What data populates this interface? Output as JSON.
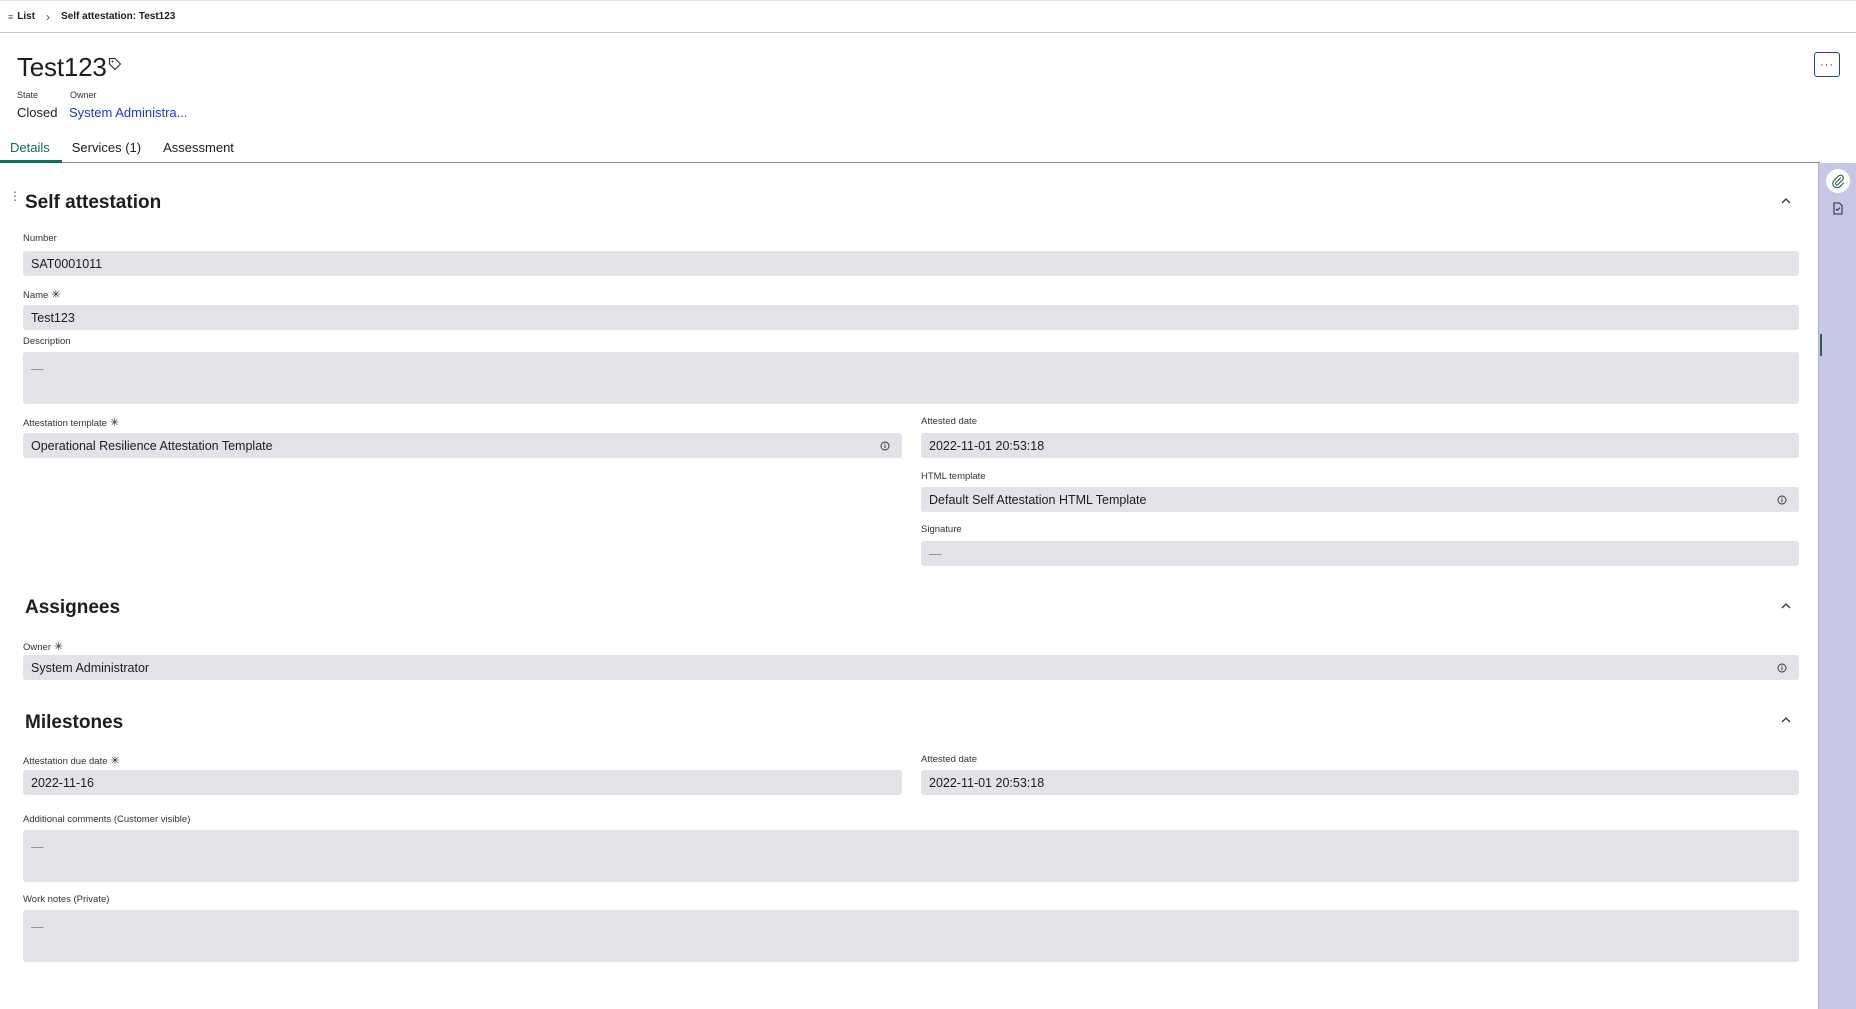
{
  "breadcrumb": {
    "list_label": "List",
    "current": "Self attestation: Test123"
  },
  "header": {
    "title": "Test123",
    "state_label": "State",
    "state_value": "Closed",
    "owner_label": "Owner",
    "owner_value": "System Administra...",
    "more_label": "···"
  },
  "tabs": [
    {
      "label": "Details",
      "active": true
    },
    {
      "label": "Services (1)",
      "active": false
    },
    {
      "label": "Assessment",
      "active": false
    }
  ],
  "sections": {
    "self_attestation": {
      "title": "Self attestation",
      "number_label": "Number",
      "number_value": "SAT0001011",
      "name_label": "Name",
      "name_value": "Test123",
      "description_label": "Description",
      "description_value": "—",
      "template_label": "Attestation template",
      "template_value": "Operational Resilience Attestation Template",
      "attested_date_label": "Attested date",
      "attested_date_value": "2022-11-01 20:53:18",
      "html_template_label": "HTML template",
      "html_template_value": "Default Self Attestation HTML Template",
      "signature_label": "Signature",
      "signature_value": "—"
    },
    "assignees": {
      "title": "Assignees",
      "owner_label": "Owner",
      "owner_value": "System Administrator"
    },
    "milestones": {
      "title": "Milestones",
      "due_date_label": "Attestation due date",
      "due_date_value": "2022-11-16",
      "attested_date_label": "Attested date",
      "attested_date_value": "2022-11-01 20:53:18",
      "comments_label": "Additional comments (Customer visible)",
      "comments_value": "—",
      "work_notes_label": "Work notes (Private)",
      "work_notes_value": "—"
    }
  },
  "required_marker": "✳",
  "icons": {
    "list": "list-icon",
    "tag": "tag-icon",
    "info": "info-icon",
    "collapse": "chevron-up-icon",
    "attachment": "paperclip-icon",
    "document": "document-icon"
  },
  "colors": {
    "accent": "#0f6e5b",
    "link": "#2337c6",
    "field_bg": "#e2e3e8",
    "rail_bg": "#c8c6e5",
    "more_border": "#1f3fbf"
  }
}
